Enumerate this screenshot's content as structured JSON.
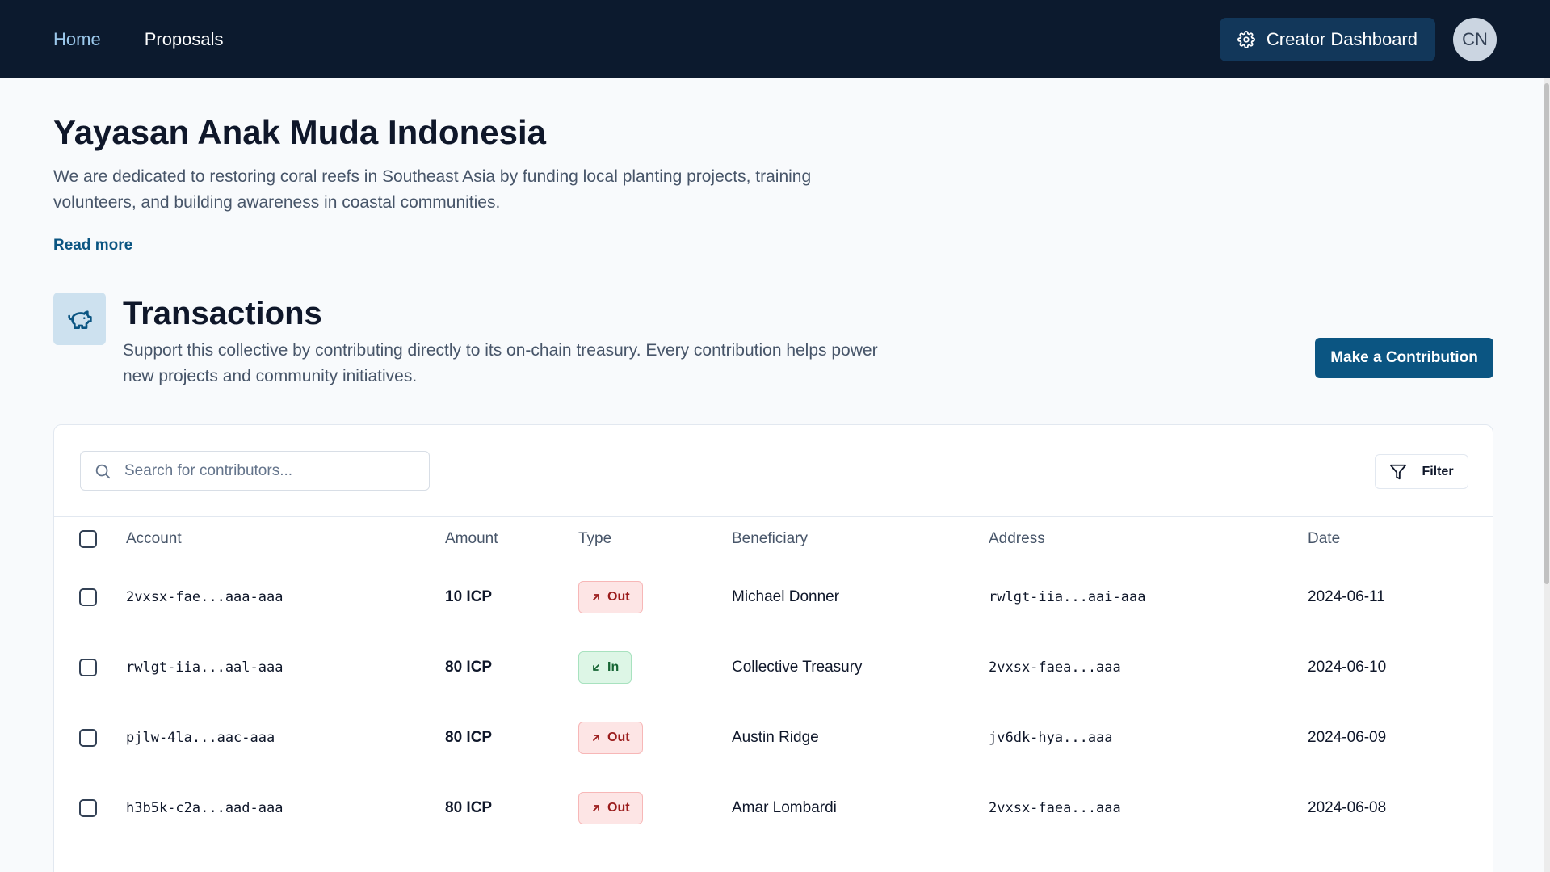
{
  "nav": {
    "home_label": "Home",
    "proposals_label": "Proposals",
    "creator_dashboard_label": "Creator Dashboard",
    "avatar_initials": "CN",
    "icons": {
      "settings": "gear-icon"
    }
  },
  "org": {
    "title": "Yayasan Anak Muda Indonesia",
    "description": "We are dedicated to restoring coral reefs in Southeast Asia by funding local planting projects, training volunteers, and building awareness in coastal communities.",
    "read_more_label": "Read more"
  },
  "transactions": {
    "icon": "piggy-bank-icon",
    "title": "Transactions",
    "description": "Support this collective by contributing directly to its on-chain treasury. Every contribution helps power new projects and community initiatives.",
    "contribute_label": "Make a Contribution",
    "search_placeholder": "Search for contributors...",
    "filter_label": "Filter",
    "columns": {
      "account": "Account",
      "amount": "Amount",
      "type": "Type",
      "beneficiary": "Beneficiary",
      "address": "Address",
      "date": "Date"
    },
    "rows": [
      {
        "account": "2vxsx-fae...aaa-aaa",
        "amount": "10 ICP",
        "type": "Out",
        "beneficiary": "Michael Donner",
        "address": "rwlgt-iia...aai-aaa",
        "date": "2024-06-11"
      },
      {
        "account": "rwlgt-iia...aal-aaa",
        "amount": "80 ICP",
        "type": "In",
        "beneficiary": "Collective Treasury",
        "address": "2vxsx-faea...aaa",
        "date": "2024-06-10"
      },
      {
        "account": "pjlw-4la...aac-aaa",
        "amount": "80 ICP",
        "type": "Out",
        "beneficiary": "Austin Ridge",
        "address": "jv6dk-hya...aaa",
        "date": "2024-06-09"
      },
      {
        "account": "h3b5k-c2a...aad-aaa",
        "amount": "80 ICP",
        "type": "Out",
        "beneficiary": "Amar Lombardi",
        "address": "2vxsx-faea...aaa",
        "date": "2024-06-08"
      }
    ],
    "colors": {
      "out_badge_bg": "#fde5e5",
      "in_badge_bg": "#ddf6e6",
      "accent": "#0b5582"
    }
  }
}
